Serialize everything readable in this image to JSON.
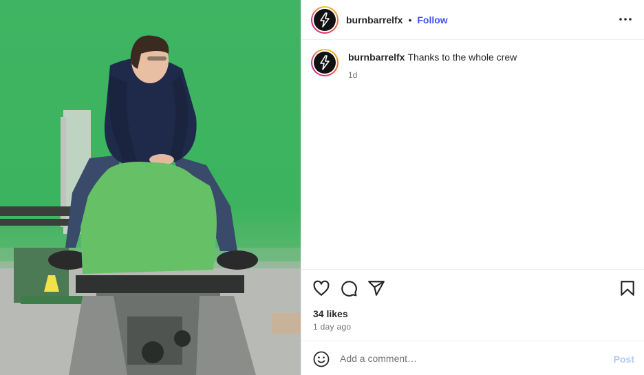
{
  "post": {
    "image_alt": "Person in a navy hoodie sitting on a motion rig in a green screen studio",
    "colors": {
      "greenscreen": "#3fb563",
      "hoodie": "#1f2a4a",
      "jeans": "#3a4a6a",
      "blur_patch": "#66c066",
      "follow": "#4150f7",
      "post_disabled": "#b3c8f5"
    }
  },
  "header": {
    "username": "burnbarrelfx",
    "separator": "•",
    "follow_label": "Follow",
    "more_icon": "more-horizontal-icon"
  },
  "caption": {
    "username": "burnbarrelfx",
    "text": "Thanks to the whole crew",
    "time": "1d"
  },
  "actions": {
    "icons": [
      "heart-icon",
      "comment-icon",
      "share-icon",
      "bookmark-icon"
    ],
    "likes": "34 likes",
    "time_ago": "1 day ago"
  },
  "comment": {
    "placeholder": "Add a comment…",
    "post_label": "Post",
    "emoji_icon": "emoji-icon"
  }
}
